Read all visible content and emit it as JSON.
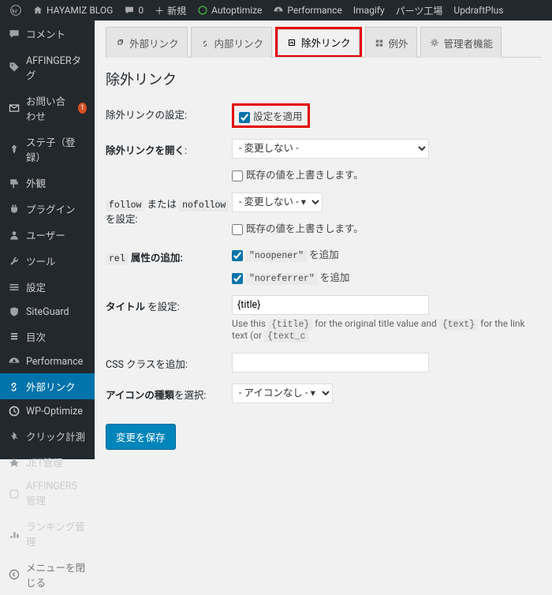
{
  "adminbar": {
    "site": "HAYAMIZ BLOG",
    "comments": "0",
    "new": "新規",
    "autoptimize": "Autoptimize",
    "performance": "Performance",
    "imagify": "Imagify",
    "parts": "パーツ工場",
    "updraft": "UpdraftPlus"
  },
  "sidebar": {
    "items": [
      {
        "label": "コメント",
        "icon": "comment"
      },
      {
        "label": "AFFINGERタグ",
        "icon": "tag"
      },
      {
        "label": "お問い合わせ",
        "icon": "mail",
        "badge": "1"
      },
      {
        "label": "ステ子（登録）",
        "icon": "pin"
      },
      {
        "label": "外観",
        "icon": "paint"
      },
      {
        "label": "プラグイン",
        "icon": "plug"
      },
      {
        "label": "ユーザー",
        "icon": "user"
      },
      {
        "label": "ツール",
        "icon": "wrench"
      },
      {
        "label": "設定",
        "icon": "sliders"
      },
      {
        "label": "SiteGuard",
        "icon": "shield"
      },
      {
        "label": "目次",
        "icon": "list"
      },
      {
        "label": "Performance",
        "icon": "gauge"
      },
      {
        "label": "外部リンク",
        "icon": "link",
        "current": true
      },
      {
        "label": "WP-Optimize",
        "icon": "opt"
      },
      {
        "label": "クリック計測",
        "icon": "click"
      },
      {
        "label": "JET管理",
        "icon": "jet"
      },
      {
        "label": "AFFINGER5 管理",
        "icon": "a5"
      },
      {
        "label": "ランキング管理",
        "icon": "rank"
      },
      {
        "label": "メニューを閉じる",
        "icon": "collapse",
        "collapse": true
      }
    ]
  },
  "tabs": [
    {
      "label": "外部リンク"
    },
    {
      "label": "内部リンク"
    },
    {
      "label": "除外リンク",
      "hl": true
    },
    {
      "label": "例外"
    },
    {
      "label": "管理者機能"
    }
  ],
  "page": {
    "title": "除外リンク",
    "rows": {
      "apply": {
        "label": "除外リンクの設定:",
        "checkbox_label": "設定を適用"
      },
      "open": {
        "label_strong": "除外リンクを開く",
        "label_after": ":",
        "select": "- 変更しない -",
        "sub": "既存の値を上書きします。"
      },
      "follow": {
        "pre": "follow",
        "mid": " または ",
        "post": "nofollow",
        "after": " を設定:",
        "select": "- 変更しない - ▾",
        "sub": "既存の値を上書きします。"
      },
      "rel": {
        "pre": "rel",
        "after": " 属性の追加:",
        "opt1": "\"noopener\"",
        "opt1_after": " を追加",
        "opt2": "\"noreferrer\"",
        "opt2_after": " を追加"
      },
      "title": {
        "strong": "タイトル",
        "after": " を設定:",
        "value": "{title}",
        "hint_a": "Use this ",
        "hint_title": "{title}",
        "hint_b": " for the original title value and ",
        "hint_text": "{text}",
        "hint_c": " for the link text (or ",
        "hint_tc": "{text_c"
      },
      "css": {
        "label": "CSS クラスを追加:",
        "value": ""
      },
      "icon": {
        "strong": "アイコンの種類",
        "after": "を選択:",
        "select": "- アイコンなし - ▾"
      }
    },
    "save": "変更を保存"
  }
}
